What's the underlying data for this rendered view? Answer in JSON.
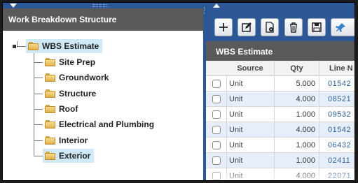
{
  "left_pane": {
    "title": "Work Breakdown Structure"
  },
  "tree": {
    "root": {
      "label": "WBS Estimate",
      "icon": "folder-icon"
    },
    "children": [
      {
        "label": "Site Prep"
      },
      {
        "label": "Groundwork"
      },
      {
        "label": "Structure"
      },
      {
        "label": "Roof"
      },
      {
        "label": "Electrical and Plumbing"
      },
      {
        "label": "Interior"
      },
      {
        "label": "Exterior"
      }
    ]
  },
  "toolbar": {
    "buttons": [
      {
        "name": "add",
        "icon": "plus-icon"
      },
      {
        "name": "edit",
        "icon": "edit-icon"
      },
      {
        "name": "document",
        "icon": "document-gear-icon"
      },
      {
        "name": "delete",
        "icon": "trash-icon"
      },
      {
        "name": "save",
        "icon": "save-icon"
      },
      {
        "name": "pin",
        "icon": "pin-icon"
      }
    ]
  },
  "grid": {
    "title": "WBS Estimate",
    "columns": [
      "Source",
      "Qty",
      "Line N"
    ],
    "rows": [
      {
        "source": "Unit",
        "qty": "5.000",
        "line": "01542"
      },
      {
        "source": "Unit",
        "qty": "4.000",
        "line": "08521"
      },
      {
        "source": "Unit",
        "qty": "1.000",
        "line": "09532"
      },
      {
        "source": "Unit",
        "qty": "4.000",
        "line": "01542"
      },
      {
        "source": "Unit",
        "qty": "1.000",
        "line": "06432"
      },
      {
        "source": "Unit",
        "qty": "1.000",
        "line": "02411"
      },
      {
        "source": "Unit",
        "qty": "4.000",
        "line": "22071"
      }
    ]
  },
  "colors": {
    "pane_blue": "#2b5797",
    "header_gray": "#5a5a5a",
    "selection": "#cfe9f7",
    "alt_row": "#e6eefb",
    "line_number": "#2a5f9e"
  }
}
